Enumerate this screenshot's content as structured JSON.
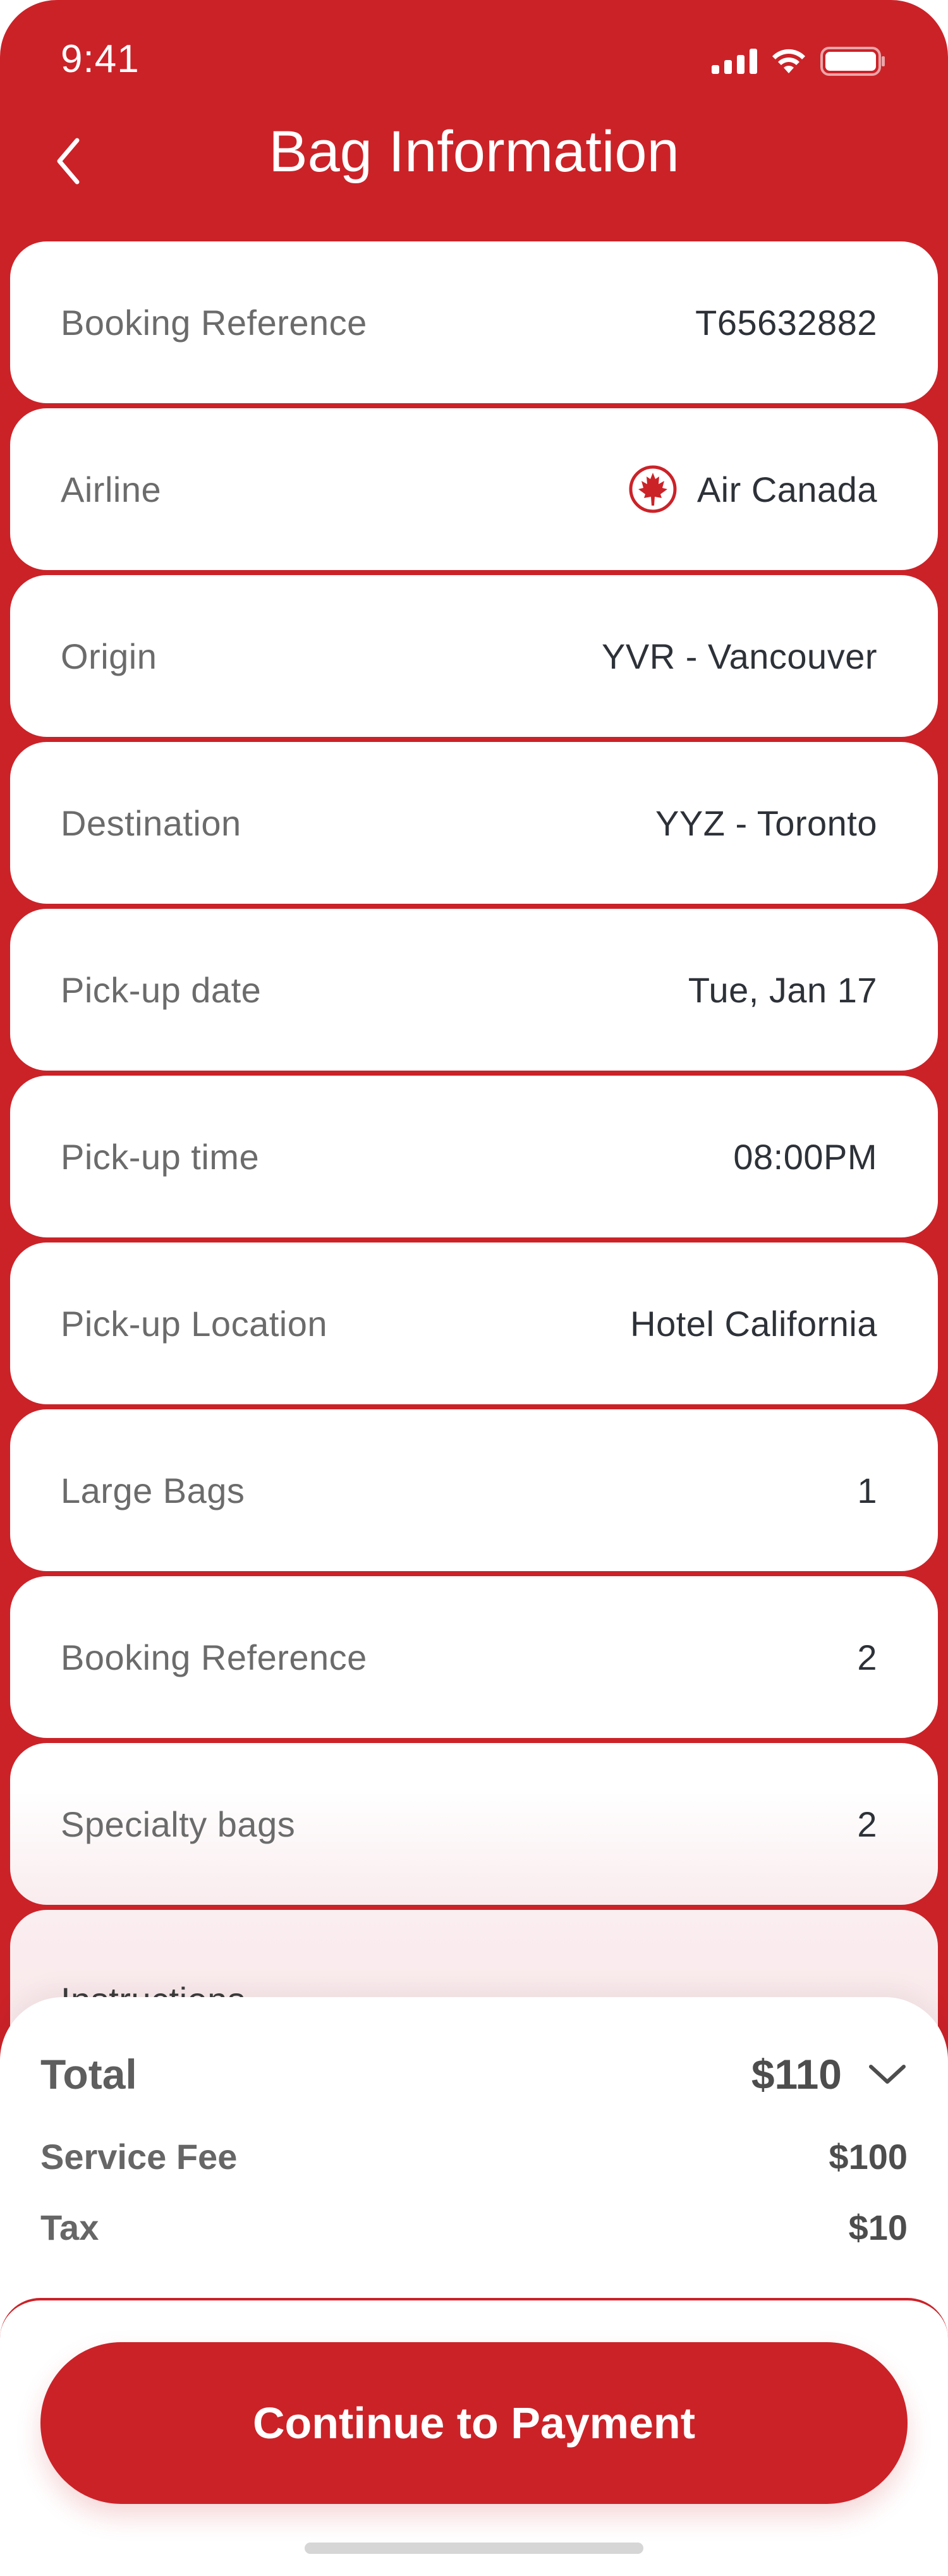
{
  "status_bar": {
    "time": "9:41"
  },
  "header": {
    "title": "Bag Information"
  },
  "rows": [
    {
      "label": "Booking Reference",
      "value": "T65632882"
    },
    {
      "label": "Airline",
      "value": "Air Canada"
    },
    {
      "label": "Origin",
      "value": "YVR - Vancouver"
    },
    {
      "label": "Destination",
      "value": "YYZ - Toronto"
    },
    {
      "label": "Pick-up date",
      "value": "Tue, Jan 17"
    },
    {
      "label": "Pick-up time",
      "value": "08:00PM"
    },
    {
      "label": "Pick-up Location",
      "value": "Hotel California"
    },
    {
      "label": "Large Bags",
      "value": "1"
    },
    {
      "label": "Booking Reference",
      "value": "2"
    },
    {
      "label": "Specialty bags",
      "value": "2"
    }
  ],
  "instructions": {
    "label": "Instructions"
  },
  "summary": {
    "total_label": "Total",
    "total_value": "$110",
    "service_fee_label": "Service Fee",
    "service_fee_value": "$100",
    "tax_label": "Tax",
    "tax_value": "$10"
  },
  "cta": {
    "label": "Continue to Payment"
  },
  "colors": {
    "brand": "#CB2228",
    "card": "#FFFFFF",
    "label_text": "#6B6B6B",
    "value_text": "#2D3138"
  },
  "icons": [
    "back-chevron-icon",
    "signal-icon",
    "wifi-icon",
    "battery-icon",
    "air-canada-logo-icon",
    "chevron-down-icon"
  ]
}
